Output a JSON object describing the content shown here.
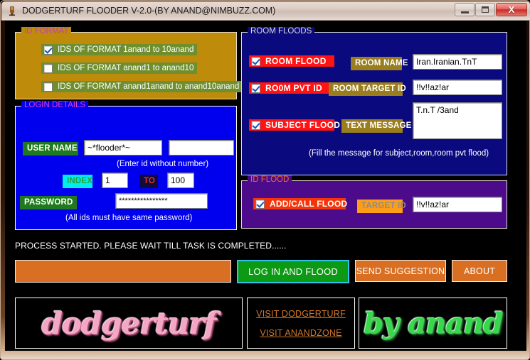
{
  "window": {
    "title": "DODGERTURF FLOODER V-2.0-(BY ANAND@NIMBUZZ.COM)",
    "minimize_label": "",
    "maximize_label": "",
    "close_label": "X"
  },
  "id_format": {
    "legend": "ID FORMAT",
    "options": [
      {
        "label": "IDS OF FORMAT 1anand to 10anand",
        "checked": true
      },
      {
        "label": "IDS OF FORMAT anand1 to anand10",
        "checked": false
      },
      {
        "label": "IDS OF FORMAT anand1anand to anand10anand",
        "checked": false
      }
    ]
  },
  "login": {
    "legend": "LOGIN DETAILS",
    "username_label": "USER NAME",
    "username_value": "~*flooder*~",
    "username_extra_value": "",
    "username_hint": "(Enter id without number)",
    "index_label": "INDEX",
    "index_from": "1",
    "to_label": "TO",
    "index_to": "100",
    "password_label": "PASSWORD",
    "password_value": "****************",
    "password_hint": "(All ids must have same password)"
  },
  "room_floods": {
    "legend": "ROOM FLOODS",
    "room_flood": {
      "label": "ROOM  FLOOD",
      "checked": true
    },
    "room_pvt_id": {
      "label": "RO0M PVT ID",
      "checked": true
    },
    "subject_flood": {
      "label": "SUBJECT FLOOD",
      "checked": true
    },
    "room_name_label": "ROOM NAME",
    "room_name_value": "Iran.Iranian.TnT",
    "room_target_label": "ROOM TARGET ID",
    "room_target_value": "!!v!!az!ar",
    "text_message_label": "TEXT MESSAGE",
    "text_message_value": "T.n.T /3and",
    "hint": "(Fill the message for subject,room,room pvt flood)"
  },
  "id_flood": {
    "legend": "ID FLOOD",
    "add_call_flood": {
      "label": "ADD/CALL FLOOD",
      "checked": true
    },
    "target_id_label": "TARGET ID",
    "target_id_value": "!!v!!az!ar"
  },
  "actions": {
    "status": "PROCESS STARTED. PLEASE WAIT TILL TASK IS COMPLETED......",
    "progress_value": "",
    "login_button": "LOG IN AND FLOOD",
    "suggestion_button": "SEND SUGGESTION",
    "about_button": "ABOUT"
  },
  "footer": {
    "brand_left": "dodgerturf",
    "link_dodgerturf": "VISIT DODGERTURF",
    "link_anandzone": "VISIT ANANDZONE",
    "brand_right": "by anand"
  },
  "colors": {
    "accent_orange": "#d96f23",
    "accent_green": "#0c9a14",
    "group_idformat_bg": "#bf8b0b",
    "group_login_bg": "#0000ef",
    "group_room_bg": "#0a0a7e",
    "group_idflood_bg": "#4b0b8a",
    "checkbox_red": "#ff1313",
    "checkbox_green": "#6f8f2e"
  }
}
